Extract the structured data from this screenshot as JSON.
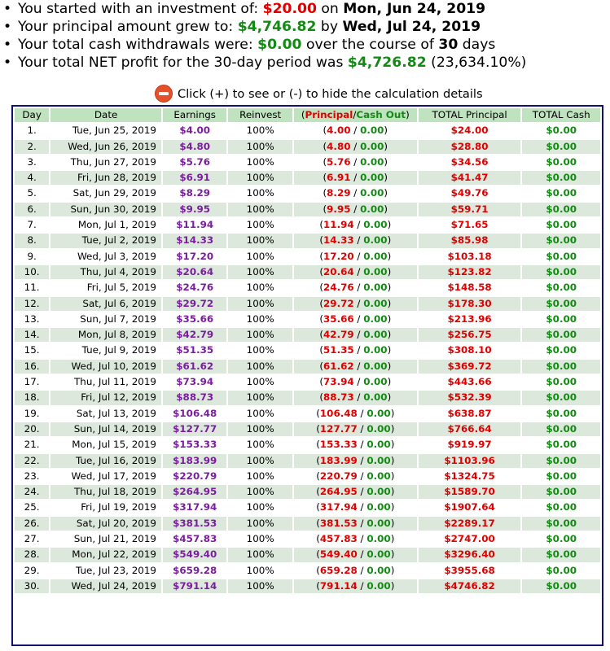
{
  "summary": {
    "bullet": "•",
    "line1": {
      "pre": "You started with an investment of: ",
      "amount": "$20.00",
      "mid": " on ",
      "date": "Mon, Jun 24, 2019"
    },
    "line2": {
      "pre": "Your principal amount grew to: ",
      "amount": "$4,746.82",
      "mid": " by ",
      "date": "Wed, Jul 24, 2019"
    },
    "line3": {
      "pre": "Your total cash withdrawals were: ",
      "amount": "$0.00",
      "mid": " over the course of ",
      "days": "30",
      "post": " days"
    },
    "line4": {
      "pre": "Your total NET profit for the 30-day period was ",
      "amount": "$4,726.82",
      "post": " (23,634.10%)"
    }
  },
  "toggle": {
    "text": "Click (+) to see or (-) to hide the calculation details"
  },
  "table": {
    "headers": {
      "day": "Day",
      "date": "Date",
      "earnings": "Earnings",
      "reinvest": "Reinvest",
      "pc_open": "(",
      "pc_principal": "Principal",
      "pc_sep": "/",
      "pc_cashout": "Cash Out",
      "pc_close": ")",
      "total_principal": "TOTAL Principal",
      "total_cash": "TOTAL Cash"
    },
    "rows": [
      {
        "day": "1.",
        "date": "Tue, Jun 25, 2019",
        "earnings": "$4.00",
        "reinvest": "100%",
        "principal": "4.00",
        "cashout": "0.00",
        "total_principal": "$24.00",
        "total_cash": "$0.00"
      },
      {
        "day": "2.",
        "date": "Wed, Jun 26, 2019",
        "earnings": "$4.80",
        "reinvest": "100%",
        "principal": "4.80",
        "cashout": "0.00",
        "total_principal": "$28.80",
        "total_cash": "$0.00"
      },
      {
        "day": "3.",
        "date": "Thu, Jun 27, 2019",
        "earnings": "$5.76",
        "reinvest": "100%",
        "principal": "5.76",
        "cashout": "0.00",
        "total_principal": "$34.56",
        "total_cash": "$0.00"
      },
      {
        "day": "4.",
        "date": "Fri, Jun 28, 2019",
        "earnings": "$6.91",
        "reinvest": "100%",
        "principal": "6.91",
        "cashout": "0.00",
        "total_principal": "$41.47",
        "total_cash": "$0.00"
      },
      {
        "day": "5.",
        "date": "Sat, Jun 29, 2019",
        "earnings": "$8.29",
        "reinvest": "100%",
        "principal": "8.29",
        "cashout": "0.00",
        "total_principal": "$49.76",
        "total_cash": "$0.00"
      },
      {
        "day": "6.",
        "date": "Sun, Jun 30, 2019",
        "earnings": "$9.95",
        "reinvest": "100%",
        "principal": "9.95",
        "cashout": "0.00",
        "total_principal": "$59.71",
        "total_cash": "$0.00"
      },
      {
        "day": "7.",
        "date": "Mon, Jul 1, 2019",
        "earnings": "$11.94",
        "reinvest": "100%",
        "principal": "11.94",
        "cashout": "0.00",
        "total_principal": "$71.65",
        "total_cash": "$0.00"
      },
      {
        "day": "8.",
        "date": "Tue, Jul 2, 2019",
        "earnings": "$14.33",
        "reinvest": "100%",
        "principal": "14.33",
        "cashout": "0.00",
        "total_principal": "$85.98",
        "total_cash": "$0.00"
      },
      {
        "day": "9.",
        "date": "Wed, Jul 3, 2019",
        "earnings": "$17.20",
        "reinvest": "100%",
        "principal": "17.20",
        "cashout": "0.00",
        "total_principal": "$103.18",
        "total_cash": "$0.00"
      },
      {
        "day": "10.",
        "date": "Thu, Jul 4, 2019",
        "earnings": "$20.64",
        "reinvest": "100%",
        "principal": "20.64",
        "cashout": "0.00",
        "total_principal": "$123.82",
        "total_cash": "$0.00"
      },
      {
        "day": "11.",
        "date": "Fri, Jul 5, 2019",
        "earnings": "$24.76",
        "reinvest": "100%",
        "principal": "24.76",
        "cashout": "0.00",
        "total_principal": "$148.58",
        "total_cash": "$0.00"
      },
      {
        "day": "12.",
        "date": "Sat, Jul 6, 2019",
        "earnings": "$29.72",
        "reinvest": "100%",
        "principal": "29.72",
        "cashout": "0.00",
        "total_principal": "$178.30",
        "total_cash": "$0.00"
      },
      {
        "day": "13.",
        "date": "Sun, Jul 7, 2019",
        "earnings": "$35.66",
        "reinvest": "100%",
        "principal": "35.66",
        "cashout": "0.00",
        "total_principal": "$213.96",
        "total_cash": "$0.00"
      },
      {
        "day": "14.",
        "date": "Mon, Jul 8, 2019",
        "earnings": "$42.79",
        "reinvest": "100%",
        "principal": "42.79",
        "cashout": "0.00",
        "total_principal": "$256.75",
        "total_cash": "$0.00"
      },
      {
        "day": "15.",
        "date": "Tue, Jul 9, 2019",
        "earnings": "$51.35",
        "reinvest": "100%",
        "principal": "51.35",
        "cashout": "0.00",
        "total_principal": "$308.10",
        "total_cash": "$0.00"
      },
      {
        "day": "16.",
        "date": "Wed, Jul 10, 2019",
        "earnings": "$61.62",
        "reinvest": "100%",
        "principal": "61.62",
        "cashout": "0.00",
        "total_principal": "$369.72",
        "total_cash": "$0.00"
      },
      {
        "day": "17.",
        "date": "Thu, Jul 11, 2019",
        "earnings": "$73.94",
        "reinvest": "100%",
        "principal": "73.94",
        "cashout": "0.00",
        "total_principal": "$443.66",
        "total_cash": "$0.00"
      },
      {
        "day": "18.",
        "date": "Fri, Jul 12, 2019",
        "earnings": "$88.73",
        "reinvest": "100%",
        "principal": "88.73",
        "cashout": "0.00",
        "total_principal": "$532.39",
        "total_cash": "$0.00"
      },
      {
        "day": "19.",
        "date": "Sat, Jul 13, 2019",
        "earnings": "$106.48",
        "reinvest": "100%",
        "principal": "106.48",
        "cashout": "0.00",
        "total_principal": "$638.87",
        "total_cash": "$0.00"
      },
      {
        "day": "20.",
        "date": "Sun, Jul 14, 2019",
        "earnings": "$127.77",
        "reinvest": "100%",
        "principal": "127.77",
        "cashout": "0.00",
        "total_principal": "$766.64",
        "total_cash": "$0.00"
      },
      {
        "day": "21.",
        "date": "Mon, Jul 15, 2019",
        "earnings": "$153.33",
        "reinvest": "100%",
        "principal": "153.33",
        "cashout": "0.00",
        "total_principal": "$919.97",
        "total_cash": "$0.00"
      },
      {
        "day": "22.",
        "date": "Tue, Jul 16, 2019",
        "earnings": "$183.99",
        "reinvest": "100%",
        "principal": "183.99",
        "cashout": "0.00",
        "total_principal": "$1103.96",
        "total_cash": "$0.00"
      },
      {
        "day": "23.",
        "date": "Wed, Jul 17, 2019",
        "earnings": "$220.79",
        "reinvest": "100%",
        "principal": "220.79",
        "cashout": "0.00",
        "total_principal": "$1324.75",
        "total_cash": "$0.00"
      },
      {
        "day": "24.",
        "date": "Thu, Jul 18, 2019",
        "earnings": "$264.95",
        "reinvest": "100%",
        "principal": "264.95",
        "cashout": "0.00",
        "total_principal": "$1589.70",
        "total_cash": "$0.00"
      },
      {
        "day": "25.",
        "date": "Fri, Jul 19, 2019",
        "earnings": "$317.94",
        "reinvest": "100%",
        "principal": "317.94",
        "cashout": "0.00",
        "total_principal": "$1907.64",
        "total_cash": "$0.00"
      },
      {
        "day": "26.",
        "date": "Sat, Jul 20, 2019",
        "earnings": "$381.53",
        "reinvest": "100%",
        "principal": "381.53",
        "cashout": "0.00",
        "total_principal": "$2289.17",
        "total_cash": "$0.00"
      },
      {
        "day": "27.",
        "date": "Sun, Jul 21, 2019",
        "earnings": "$457.83",
        "reinvest": "100%",
        "principal": "457.83",
        "cashout": "0.00",
        "total_principal": "$2747.00",
        "total_cash": "$0.00"
      },
      {
        "day": "28.",
        "date": "Mon, Jul 22, 2019",
        "earnings": "$549.40",
        "reinvest": "100%",
        "principal": "549.40",
        "cashout": "0.00",
        "total_principal": "$3296.40",
        "total_cash": "$0.00"
      },
      {
        "day": "29.",
        "date": "Tue, Jul 23, 2019",
        "earnings": "$659.28",
        "reinvest": "100%",
        "principal": "659.28",
        "cashout": "0.00",
        "total_principal": "$3955.68",
        "total_cash": "$0.00"
      },
      {
        "day": "30.",
        "date": "Wed, Jul 24, 2019",
        "earnings": "$791.14",
        "reinvest": "100%",
        "principal": "791.14",
        "cashout": "0.00",
        "total_principal": "$4746.82",
        "total_cash": "$0.00"
      }
    ]
  }
}
